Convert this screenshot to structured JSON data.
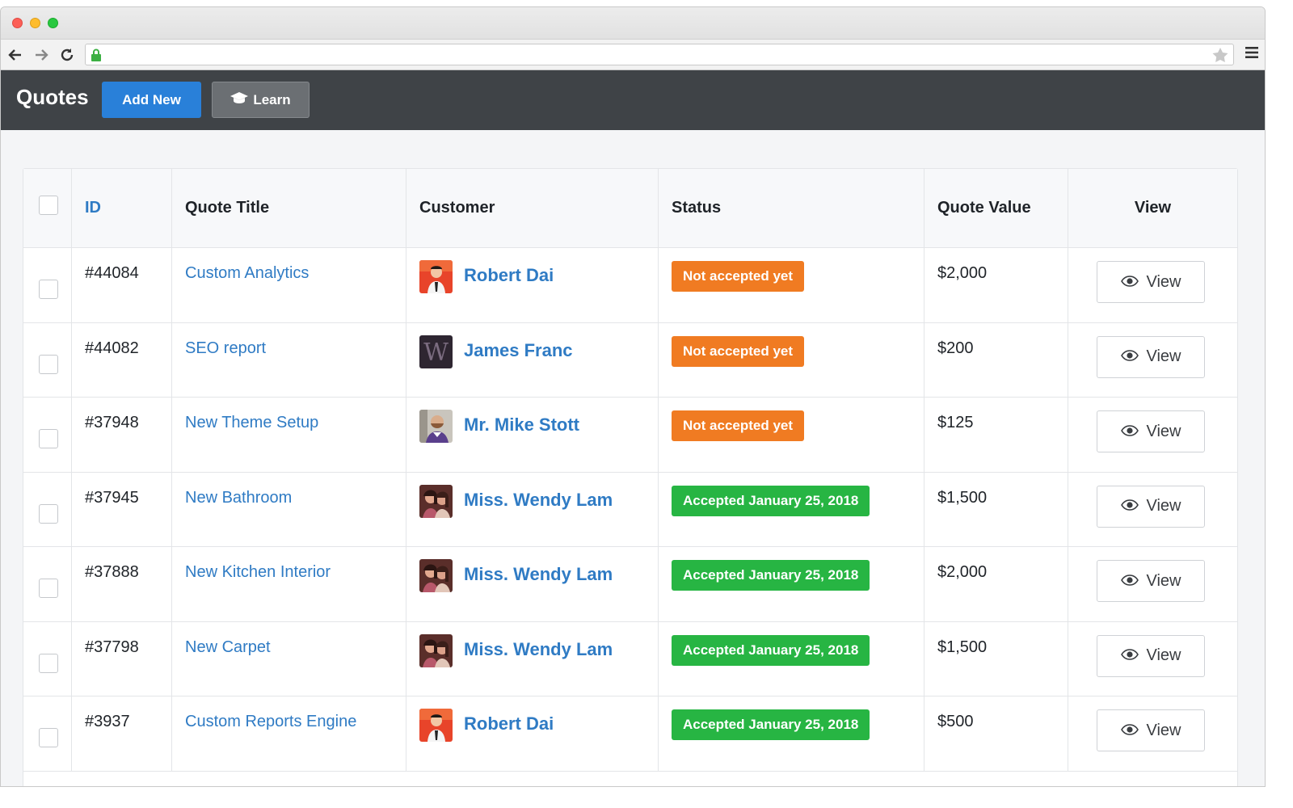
{
  "app": {
    "title": "Quotes",
    "add_new_label": "Add New",
    "learn_label": "Learn"
  },
  "table": {
    "headers": {
      "id": "ID",
      "title": "Quote Title",
      "customer": "Customer",
      "status": "Status",
      "value": "Quote Value",
      "view": "View"
    },
    "rows": [
      {
        "id": "#44084",
        "title": "Custom Analytics",
        "customer": "Robert Dai",
        "status": "Not accepted yet",
        "status_type": "pending",
        "value": "$2,000",
        "view": "View",
        "avatar_icon": "robert-avatar"
      },
      {
        "id": "#44082",
        "title": "SEO report",
        "customer": "James Franc",
        "status": "Not accepted yet",
        "status_type": "pending",
        "value": "$200",
        "view": "View",
        "avatar_icon": "w-logo-avatar"
      },
      {
        "id": "#37948",
        "title": "New Theme Setup",
        "customer": "Mr. Mike Stott",
        "status": "Not accepted yet",
        "status_type": "pending",
        "value": "$125",
        "view": "View",
        "avatar_icon": "mike-avatar"
      },
      {
        "id": "#37945",
        "title": "New Bathroom",
        "customer": "Miss. Wendy Lam",
        "status": "Accepted January 25, 2018",
        "status_type": "accepted",
        "value": "$1,500",
        "view": "View",
        "avatar_icon": "wendy-avatar"
      },
      {
        "id": "#37888",
        "title": "New Kitchen Interior",
        "customer": "Miss. Wendy Lam",
        "status": "Accepted January 25, 2018",
        "status_type": "accepted",
        "value": "$2,000",
        "view": "View",
        "avatar_icon": "wendy-avatar"
      },
      {
        "id": "#37798",
        "title": "New Carpet",
        "customer": "Miss. Wendy Lam",
        "status": "Accepted January 25, 2018",
        "status_type": "accepted",
        "value": "$1,500",
        "view": "View",
        "avatar_icon": "wendy-avatar"
      },
      {
        "id": "#3937",
        "title": "Custom Reports Engine",
        "customer": "Robert Dai",
        "status": "Accepted January 25, 2018",
        "status_type": "accepted",
        "value": "$500",
        "view": "View",
        "avatar_icon": "robert-avatar"
      }
    ]
  },
  "colors": {
    "appbar": "#3f4347",
    "primary": "#2980d9",
    "link": "#2f7bc4",
    "pending": "#f07b22",
    "accepted": "#27b543"
  }
}
